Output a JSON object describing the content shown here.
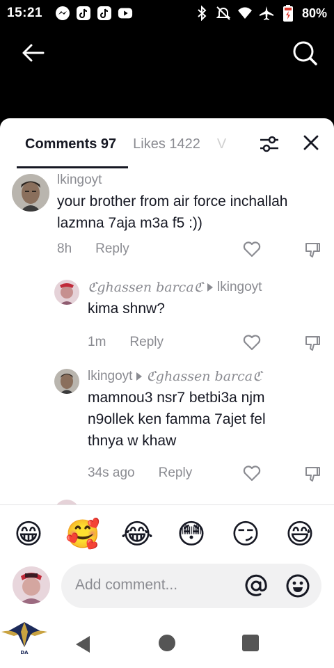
{
  "status_bar": {
    "time": "15:21",
    "battery": "80%",
    "notification_icons": [
      "messenger-icon",
      "tiktok-icon",
      "tiktok-icon",
      "youtube-icon"
    ],
    "system_icons": [
      "bluetooth-icon",
      "mute-icon",
      "wifi-icon",
      "airplane-icon",
      "battery-charging-icon"
    ]
  },
  "tabs": {
    "comments_label": "Comments 97",
    "likes_label": "Likes 1422",
    "faded_label": "V"
  },
  "comments": [
    {
      "user": "lkingoyt",
      "text_lines": [
        "your brother from air force inchallah",
        "lazmna 7aja m3a f5 :))"
      ],
      "time": "8h",
      "reply_label": "Reply"
    },
    {
      "user": "ℭghassen barcaℭ",
      "reply_to": "lkingoyt",
      "text_lines": [
        "kima shnw?"
      ],
      "time": "1m",
      "reply_label": "Reply"
    },
    {
      "user": "lkingoyt",
      "reply_to": "ℭghassen barcaℭ",
      "text_lines": [
        "mamnou3 nsr7 betbi3a njm",
        "n9ollek ken famma 7ajet fel",
        "thnya w khaw"
      ],
      "time": "34s ago",
      "reply_label": "Reply"
    }
  ],
  "emoji_bar": [
    "😁",
    "🥰",
    "😂",
    "😳",
    "😏",
    "😅"
  ],
  "composer": {
    "placeholder": "Add comment..."
  },
  "colors": {
    "text_primary": "#161823",
    "text_secondary": "#8a8b91",
    "sheet_bg": "#ffffff",
    "input_bg": "#f1f1f2"
  }
}
